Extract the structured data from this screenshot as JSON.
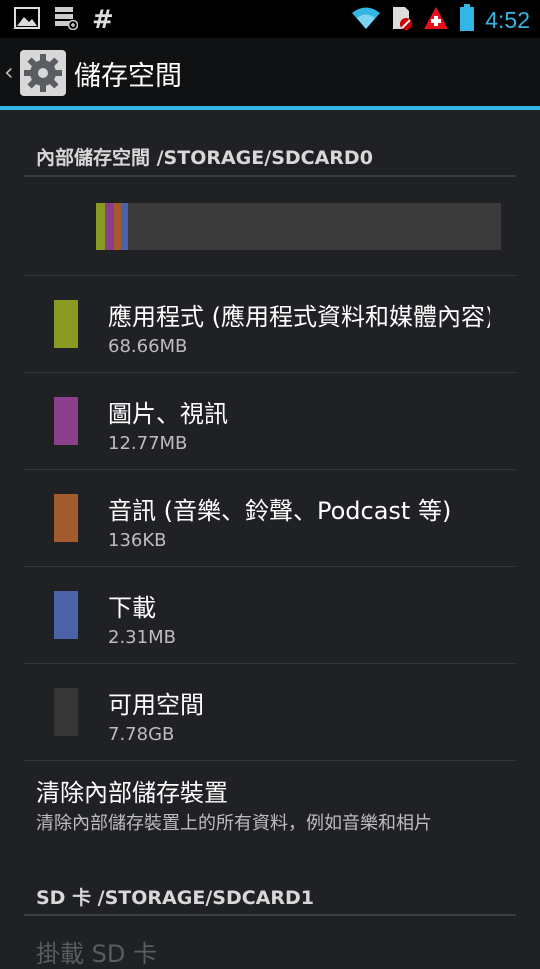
{
  "status_bar": {
    "time": "4:52",
    "icons": [
      "gallery-icon",
      "sd-card-icon",
      "hash-icon",
      "wifi-icon",
      "sd-warning-icon",
      "swiss-cross-icon",
      "battery-icon"
    ]
  },
  "action_bar": {
    "title": "儲存空間",
    "icon": "settings-gear-icon"
  },
  "internal": {
    "header": "內部儲存空間 /STORAGE/SDCARD0",
    "usage": [
      {
        "category": "apps",
        "color": "#8a9a21",
        "fraction": 0.022
      },
      {
        "category": "pictures",
        "color": "#8a3f8a",
        "fraction": 0.022
      },
      {
        "category": "audio",
        "color": "#a45b2e",
        "fraction": 0.018
      },
      {
        "category": "downloads",
        "color": "#4a62a8",
        "fraction": 0.018
      }
    ],
    "items": [
      {
        "label": "應用程式 (應用程式資料和媒體內容)",
        "size": "68.66MB",
        "color": "#8a9a21"
      },
      {
        "label": "圖片、視訊",
        "size": "12.77MB",
        "color": "#8a3f8a"
      },
      {
        "label": "音訊 (音樂、鈴聲、Podcast 等)",
        "size": "136KB",
        "color": "#a45b2e"
      },
      {
        "label": "下載",
        "size": "2.31MB",
        "color": "#4a62a8"
      },
      {
        "label": "可用空間",
        "size": "7.78GB",
        "color": "#363636"
      }
    ],
    "erase_title": "清除內部儲存裝置",
    "erase_desc": "清除內部儲存裝置上的所有資料，例如音樂和相片"
  },
  "sdcard": {
    "header": "SD 卡 /STORAGE/SDCARD1",
    "mount_label": "掛載 SD 卡"
  }
}
